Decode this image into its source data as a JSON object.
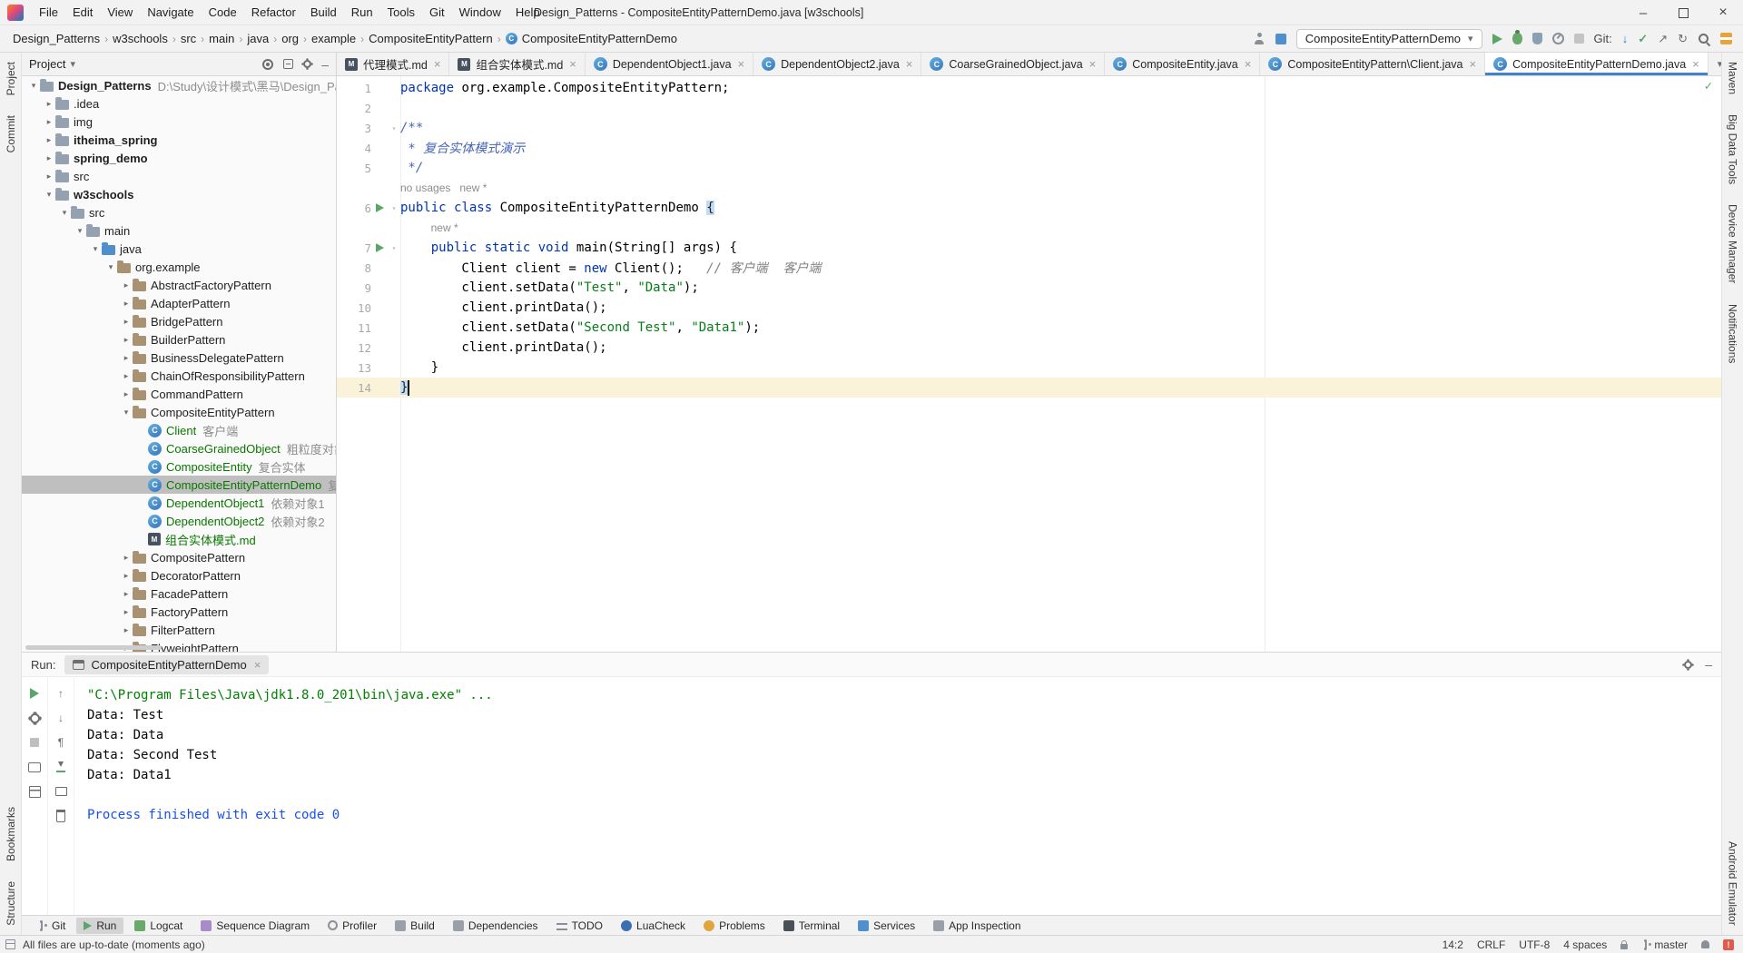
{
  "window": {
    "title": "Design_Patterns - CompositeEntityPatternDemo.java [w3schools]"
  },
  "menu_bar": {
    "items": [
      "File",
      "Edit",
      "View",
      "Navigate",
      "Code",
      "Refactor",
      "Build",
      "Run",
      "Tools",
      "Git",
      "Window",
      "Help"
    ]
  },
  "toolbar": {
    "breadcrumbs": [
      "Design_Patterns",
      "w3schools",
      "src",
      "main",
      "java",
      "org",
      "example",
      "CompositeEntityPattern",
      "CompositeEntityPatternDemo"
    ],
    "run_config": "CompositeEntityPatternDemo",
    "git_label": "Git:"
  },
  "left_stripe": {
    "top": [
      "Project",
      "Commit"
    ],
    "bottom": [
      "Bookmarks",
      "Structure"
    ]
  },
  "right_stripe": {
    "top": [
      "Maven",
      "Big Data Tools",
      "Device Manager",
      "Notifications"
    ],
    "bottom": [
      "Android Emulator"
    ]
  },
  "project_panel": {
    "title": "Project",
    "tree": [
      {
        "label": "Design_Patterns",
        "suffix": "D:\\Study\\设计模式\\黑马\\Design_Patt",
        "icon": "folder",
        "level": 0,
        "expand": "open",
        "bold": true
      },
      {
        "label": ".idea",
        "icon": "folder",
        "level": 1,
        "expand": "closed"
      },
      {
        "label": "img",
        "icon": "folder",
        "level": 1,
        "expand": "closed"
      },
      {
        "label": "itheima_spring",
        "icon": "folder",
        "level": 1,
        "expand": "closed",
        "bold": true
      },
      {
        "label": "spring_demo",
        "icon": "folder",
        "level": 1,
        "expand": "closed",
        "bold": true
      },
      {
        "label": "src",
        "icon": "folder",
        "level": 1,
        "expand": "closed"
      },
      {
        "label": "w3schools",
        "icon": "folder",
        "level": 1,
        "expand": "open",
        "bold": true
      },
      {
        "label": "src",
        "icon": "folder",
        "level": 2,
        "expand": "open"
      },
      {
        "label": "main",
        "icon": "folder",
        "level": 3,
        "expand": "open"
      },
      {
        "label": "java",
        "icon": "folder-src",
        "level": 4,
        "expand": "open"
      },
      {
        "label": "org.example",
        "icon": "package",
        "level": 5,
        "expand": "open"
      },
      {
        "label": "AbstractFactoryPattern",
        "icon": "package",
        "level": 6,
        "expand": "closed"
      },
      {
        "label": "AdapterPattern",
        "icon": "package",
        "level": 6,
        "expand": "closed"
      },
      {
        "label": "BridgePattern",
        "icon": "package",
        "level": 6,
        "expand": "closed"
      },
      {
        "label": "BuilderPattern",
        "icon": "package",
        "level": 6,
        "expand": "closed"
      },
      {
        "label": "BusinessDelegatePattern",
        "icon": "package",
        "level": 6,
        "expand": "closed"
      },
      {
        "label": "ChainOfResponsibilityPattern",
        "icon": "package",
        "level": 6,
        "expand": "closed"
      },
      {
        "label": "CommandPattern",
        "icon": "package",
        "level": 6,
        "expand": "closed"
      },
      {
        "label": "CompositeEntityPattern",
        "icon": "package",
        "level": 6,
        "expand": "open"
      },
      {
        "label": "Client",
        "suffix": "客户端",
        "icon": "class",
        "level": 7,
        "added": true
      },
      {
        "label": "CoarseGrainedObject",
        "suffix": "粗粒度对象",
        "icon": "class",
        "level": 7,
        "added": true
      },
      {
        "label": "CompositeEntity",
        "suffix": "复合实体",
        "icon": "class",
        "level": 7,
        "added": true
      },
      {
        "label": "CompositeEntityPatternDemo",
        "suffix": "复合实体模式演示",
        "icon": "class",
        "level": 7,
        "added": true,
        "selected": true
      },
      {
        "label": "DependentObject1",
        "suffix": "依赖对象1",
        "icon": "class",
        "level": 7,
        "added": true
      },
      {
        "label": "DependentObject2",
        "suffix": "依赖对象2",
        "icon": "class",
        "level": 7,
        "added": true
      },
      {
        "label": "组合实体模式.md",
        "icon": "md",
        "level": 7,
        "added": true
      },
      {
        "label": "CompositePattern",
        "icon": "package",
        "level": 6,
        "expand": "closed"
      },
      {
        "label": "DecoratorPattern",
        "icon": "package",
        "level": 6,
        "expand": "closed"
      },
      {
        "label": "FacadePattern",
        "icon": "package",
        "level": 6,
        "expand": "closed"
      },
      {
        "label": "FactoryPattern",
        "icon": "package",
        "level": 6,
        "expand": "closed"
      },
      {
        "label": "FilterPattern",
        "icon": "package",
        "level": 6,
        "expand": "closed"
      },
      {
        "label": "FlyweightPattern",
        "icon": "package",
        "level": 6,
        "expand": "closed"
      }
    ]
  },
  "editor": {
    "tabs": [
      {
        "label": "代理模式.md",
        "icon": "md"
      },
      {
        "label": "组合实体模式.md",
        "icon": "md"
      },
      {
        "label": "DependentObject1.java",
        "icon": "class"
      },
      {
        "label": "DependentObject2.java",
        "icon": "class"
      },
      {
        "label": "CoarseGrainedObject.java",
        "icon": "class"
      },
      {
        "label": "CompositeEntity.java",
        "icon": "class"
      },
      {
        "label": "CompositeEntityPattern\\Client.java",
        "icon": "class"
      },
      {
        "label": "CompositeEntityPatternDemo.java",
        "icon": "class",
        "active": true
      }
    ],
    "rows": [
      {
        "type": "code",
        "num": 1,
        "tokens": [
          {
            "t": "package",
            "c": "kw"
          },
          {
            "t": " org.example.CompositeEntityPattern;"
          }
        ]
      },
      {
        "type": "code",
        "num": 2,
        "tokens": []
      },
      {
        "type": "code",
        "num": 3,
        "fold": true,
        "tokens": [
          {
            "t": "/**",
            "c": "doc"
          }
        ]
      },
      {
        "type": "code",
        "num": 4,
        "tokens": [
          {
            "t": " * 复合实体模式演示",
            "c": "doc"
          }
        ]
      },
      {
        "type": "code",
        "num": 5,
        "tokens": [
          {
            "t": " */",
            "c": "doc"
          }
        ]
      },
      {
        "type": "hint",
        "text": "no usages   new *",
        "indent": 0
      },
      {
        "type": "code",
        "num": 6,
        "run": true,
        "fold": true,
        "tokens": [
          {
            "t": "public",
            "c": "kw"
          },
          {
            "t": " "
          },
          {
            "t": "class",
            "c": "kw"
          },
          {
            "t": " CompositeEntityPatternDemo "
          },
          {
            "t": "{",
            "c": "brc"
          }
        ]
      },
      {
        "type": "hint",
        "text": "new *",
        "indent": 4
      },
      {
        "type": "code",
        "num": 7,
        "run": true,
        "fold": true,
        "tokens": [
          {
            "t": "    "
          },
          {
            "t": "public",
            "c": "kw"
          },
          {
            "t": " "
          },
          {
            "t": "static",
            "c": "kw"
          },
          {
            "t": " "
          },
          {
            "t": "void",
            "c": "kw"
          },
          {
            "t": " main(String[] args) {"
          }
        ]
      },
      {
        "type": "code",
        "num": 8,
        "tokens": [
          {
            "t": "        Client client = "
          },
          {
            "t": "new",
            "c": "kw"
          },
          {
            "t": " Client();   "
          },
          {
            "t": "// 客户端  客户端",
            "c": "cmt"
          }
        ]
      },
      {
        "type": "code",
        "num": 9,
        "tokens": [
          {
            "t": "        client.setData("
          },
          {
            "t": "\"Test\"",
            "c": "str"
          },
          {
            "t": ", "
          },
          {
            "t": "\"Data\"",
            "c": "str"
          },
          {
            "t": ");"
          }
        ]
      },
      {
        "type": "code",
        "num": 10,
        "tokens": [
          {
            "t": "        client.printData();"
          }
        ]
      },
      {
        "type": "code",
        "num": 11,
        "tokens": [
          {
            "t": "        client.setData("
          },
          {
            "t": "\"Second Test\"",
            "c": "str"
          },
          {
            "t": ", "
          },
          {
            "t": "\"Data1\"",
            "c": "str"
          },
          {
            "t": ");"
          }
        ]
      },
      {
        "type": "code",
        "num": 12,
        "tokens": [
          {
            "t": "        client.printData();"
          }
        ]
      },
      {
        "type": "code",
        "num": 13,
        "tokens": [
          {
            "t": "    }"
          }
        ]
      },
      {
        "type": "code",
        "num": 14,
        "current": true,
        "caret": true,
        "tokens": [
          {
            "t": "}",
            "c": "brc"
          }
        ]
      }
    ]
  },
  "run_panel": {
    "label": "Run:",
    "tab_label": "CompositeEntityPatternDemo",
    "main_toolbar": [
      "rerun",
      "settings",
      "stop",
      "dump-threads",
      "restore-layout"
    ],
    "console_toolbar": [
      "up-stack",
      "down-stack",
      "soft-wrap",
      "scroll-end",
      "print",
      "clear"
    ],
    "console": [
      {
        "text": "\"C:\\Program Files\\Java\\jdk1.8.0_201\\bin\\java.exe\" ...",
        "kind": "command"
      },
      {
        "text": "Data: Test",
        "kind": "stdout"
      },
      {
        "text": "Data: Data",
        "kind": "stdout"
      },
      {
        "text": "Data: Second Test",
        "kind": "stdout"
      },
      {
        "text": "Data: Data1",
        "kind": "stdout"
      },
      {
        "text": "",
        "kind": "stdout"
      },
      {
        "text": "Process finished with exit code 0",
        "kind": "system"
      }
    ]
  },
  "bottom_bar": {
    "items": [
      {
        "label": "Git",
        "icon": "git-branch"
      },
      {
        "label": "Run",
        "icon": "run",
        "active": true
      },
      {
        "label": "Logcat",
        "icon": "logcat"
      },
      {
        "label": "Sequence Diagram",
        "icon": "sequence"
      },
      {
        "label": "Profiler",
        "icon": "profiler"
      },
      {
        "label": "Build",
        "icon": "build"
      },
      {
        "label": "Dependencies",
        "icon": "dependencies"
      },
      {
        "label": "TODO",
        "icon": "todo"
      },
      {
        "label": "LuaCheck",
        "icon": "luacheck"
      },
      {
        "label": "Problems",
        "icon": "problems"
      },
      {
        "label": "Terminal",
        "icon": "terminal"
      },
      {
        "label": "Services",
        "icon": "services"
      },
      {
        "label": "App Inspection",
        "icon": "app-inspection"
      }
    ]
  },
  "status_bar": {
    "message": "All files are up-to-date (moments ago)",
    "caret_position": "14:2",
    "line_separator": "CRLF",
    "encoding": "UTF-8",
    "indent": "4 spaces",
    "branch": "master"
  },
  "colors": {
    "keyword": "#0033B3",
    "string": "#067D17",
    "doc_comment": "#4665B4",
    "line_comment": "#808080",
    "added_file_green": "#0A7700",
    "run_green": "#5BA56B",
    "active_tab_underline": "#4083C9",
    "process_finished_blue": "#1750EB",
    "caret_line": "#FBF3D9",
    "console_command_green": "#008000"
  }
}
